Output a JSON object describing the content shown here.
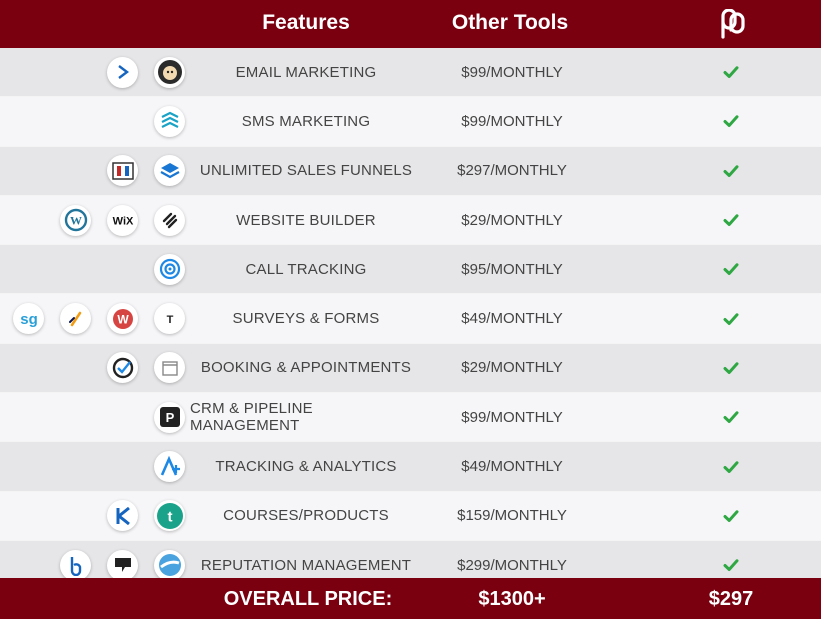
{
  "header": {
    "features": "Features",
    "other_tools": "Other Tools",
    "brand_logo": "brand-logo-icon"
  },
  "rows": [
    {
      "feature": "EMAIL MARKETING",
      "price": "$99/MONTHLY",
      "included": true,
      "icons": [
        "activecampaign-icon",
        "mailchimp-icon"
      ]
    },
    {
      "feature": "SMS MARKETING",
      "price": "$99/MONTHLY",
      "included": true,
      "icons": [
        "sms-layers-icon"
      ]
    },
    {
      "feature": "UNLIMITED SALES FUNNELS",
      "price": "$297/MONTHLY",
      "included": true,
      "icons": [
        "clickfunnels-icon",
        "leadpages-icon"
      ]
    },
    {
      "feature": "WEBSITE BUILDER",
      "price": "$29/MONTHLY",
      "included": true,
      "icons": [
        "wordpress-icon",
        "wix-icon",
        "squarespace-icon"
      ]
    },
    {
      "feature": "CALL TRACKING",
      "price": "$95/MONTHLY",
      "included": true,
      "icons": [
        "calltracking-icon"
      ]
    },
    {
      "feature": "SURVEYS & FORMS",
      "price": "$49/MONTHLY",
      "included": true,
      "icons": [
        "surveygizmo-icon",
        "jotform-icon",
        "wufoo-icon",
        "typeform-icon"
      ]
    },
    {
      "feature": "BOOKING & APPOINTMENTS",
      "price": "$29/MONTHLY",
      "included": true,
      "icons": [
        "acuity-icon",
        "calendar-icon"
      ]
    },
    {
      "feature": "CRM & PIPELINE MANAGEMENT",
      "price": "$99/MONTHLY",
      "included": true,
      "icons": [
        "pipedrive-icon"
      ]
    },
    {
      "feature": "TRACKING & ANALYTICS",
      "price": "$49/MONTHLY",
      "included": true,
      "icons": [
        "analytics-icon"
      ]
    },
    {
      "feature": "COURSES/PRODUCTS",
      "price": "$159/MONTHLY",
      "included": true,
      "icons": [
        "kajabi-icon",
        "teachable-icon"
      ]
    },
    {
      "feature": "REPUTATION MANAGEMENT",
      "price": "$299/MONTHLY",
      "included": true,
      "icons": [
        "birdeye-icon",
        "podium-icon",
        "reputation-icon"
      ]
    }
  ],
  "footer": {
    "label": "OVERALL PRICE:",
    "other_total": "$1300+",
    "our_total": "$297"
  },
  "colors": {
    "brand": "#7a0010",
    "check": "#2fa844",
    "row_dark": "#e6e6e8",
    "row_light": "#f6f6f8"
  }
}
